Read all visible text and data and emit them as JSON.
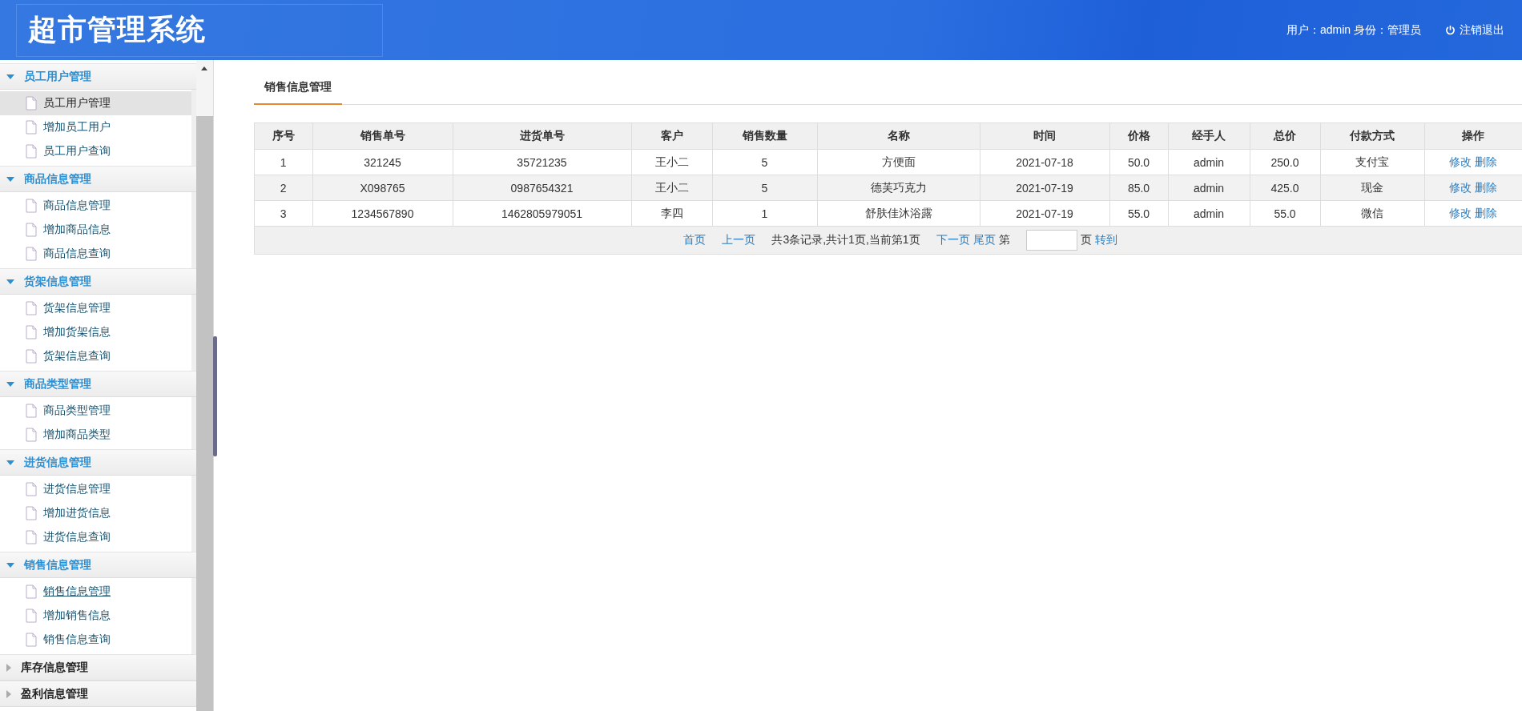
{
  "header": {
    "title": "超市管理系统",
    "user_info": "用户：admin 身份：管理员",
    "logout": "注销退出"
  },
  "sidebar": {
    "groups": [
      {
        "title": "员工用户管理",
        "expanded": true,
        "items": [
          {
            "label": "员工用户管理",
            "selected": true,
            "underlined": false
          },
          {
            "label": "增加员工用户",
            "selected": false,
            "underlined": false
          },
          {
            "label": "员工用户查询",
            "selected": false,
            "underlined": false
          }
        ]
      },
      {
        "title": "商品信息管理",
        "expanded": true,
        "items": [
          {
            "label": "商品信息管理",
            "selected": false,
            "underlined": false
          },
          {
            "label": "增加商品信息",
            "selected": false,
            "underlined": false
          },
          {
            "label": "商品信息查询",
            "selected": false,
            "underlined": false
          }
        ]
      },
      {
        "title": "货架信息管理",
        "expanded": true,
        "items": [
          {
            "label": "货架信息管理",
            "selected": false,
            "underlined": false
          },
          {
            "label": "增加货架信息",
            "selected": false,
            "underlined": false
          },
          {
            "label": "货架信息查询",
            "selected": false,
            "underlined": false
          }
        ]
      },
      {
        "title": "商品类型管理",
        "expanded": true,
        "items": [
          {
            "label": "商品类型管理",
            "selected": false,
            "underlined": false
          },
          {
            "label": "增加商品类型",
            "selected": false,
            "underlined": false
          }
        ]
      },
      {
        "title": "进货信息管理",
        "expanded": true,
        "items": [
          {
            "label": "进货信息管理",
            "selected": false,
            "underlined": false
          },
          {
            "label": "增加进货信息",
            "selected": false,
            "underlined": false
          },
          {
            "label": "进货信息查询",
            "selected": false,
            "underlined": false
          }
        ]
      },
      {
        "title": "销售信息管理",
        "expanded": true,
        "items": [
          {
            "label": "销售信息管理",
            "selected": false,
            "underlined": true
          },
          {
            "label": "增加销售信息",
            "selected": false,
            "underlined": false
          },
          {
            "label": "销售信息查询",
            "selected": false,
            "underlined": false
          }
        ]
      },
      {
        "title": "库存信息管理",
        "expanded": false
      },
      {
        "title": "盈利信息管理",
        "expanded": false
      }
    ]
  },
  "tabs": [
    {
      "label": "销售信息管理",
      "selected": true
    }
  ],
  "table": {
    "columns": [
      "序号",
      "销售单号",
      "进货单号",
      "客户",
      "销售数量",
      "名称",
      "时间",
      "价格",
      "经手人",
      "总价",
      "付款方式",
      "操作"
    ],
    "rows": [
      {
        "cells": [
          "1",
          "321245",
          "35721235",
          "王小二",
          "5",
          "方便面",
          "2021-07-18",
          "50.0",
          "admin",
          "250.0",
          "支付宝"
        ],
        "actions": [
          "修改",
          "删除"
        ]
      },
      {
        "cells": [
          "2",
          "X098765",
          "0987654321",
          "王小二",
          "5",
          "德芙巧克力",
          "2021-07-19",
          "85.0",
          "admin",
          "425.0",
          "现金"
        ],
        "actions": [
          "修改",
          "删除"
        ]
      },
      {
        "cells": [
          "3",
          "1234567890",
          "1462805979051",
          "李四",
          "1",
          "舒肤佳沐浴露",
          "2021-07-19",
          "55.0",
          "admin",
          "55.0",
          "微信"
        ],
        "actions": [
          "修改",
          "删除"
        ]
      }
    ]
  },
  "pagination": {
    "first": "首页",
    "prev": "上一页",
    "summary": "共3条记录,共计1页,当前第1页",
    "next": "下一页",
    "last": "尾页",
    "page_label_before": "第",
    "page_label_after": "页",
    "go": "转到"
  }
}
